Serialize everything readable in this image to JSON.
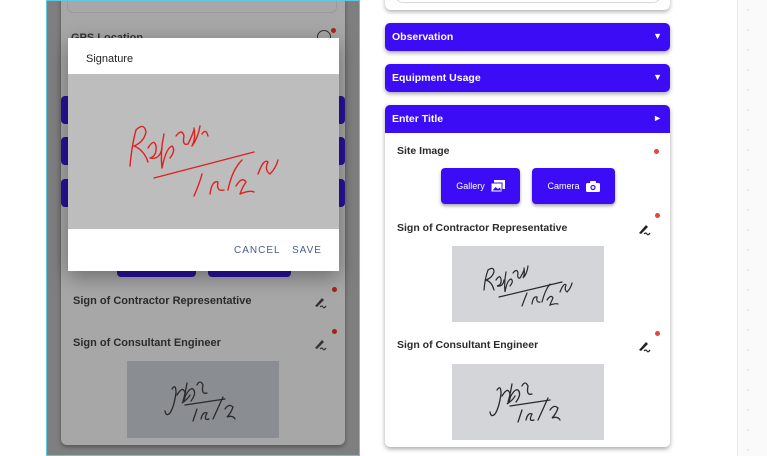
{
  "left_phone": {
    "gps_label": "GPS Location",
    "sign_contractor_label": "Sign of Contractor Representative",
    "sign_consultant_label": "Sign of Consultant Engineer"
  },
  "modal": {
    "title": "Signature",
    "cancel_label": "CANCEL",
    "save_label": "SAVE"
  },
  "right_panel": {
    "accordions": [
      {
        "label": "Observation",
        "arrow": "▼"
      },
      {
        "label": "Equipment Usage",
        "arrow": "▼"
      },
      {
        "label": "Enter Title",
        "arrow": "►"
      }
    ],
    "site_image_label": "Site Image",
    "gallery_label": "Gallery",
    "camera_label": "Camera",
    "sign_contractor_label": "Sign of Contractor Representative",
    "sign_consultant_label": "Sign of Consultant Engineer"
  },
  "colors": {
    "accent": "#3b0cf5",
    "required_dot": "#e2483a",
    "dialog_action": "#4b5b95"
  },
  "icons": [
    "gps-icon",
    "gallery-icon",
    "camera-icon",
    "signature-edit-icon"
  ]
}
